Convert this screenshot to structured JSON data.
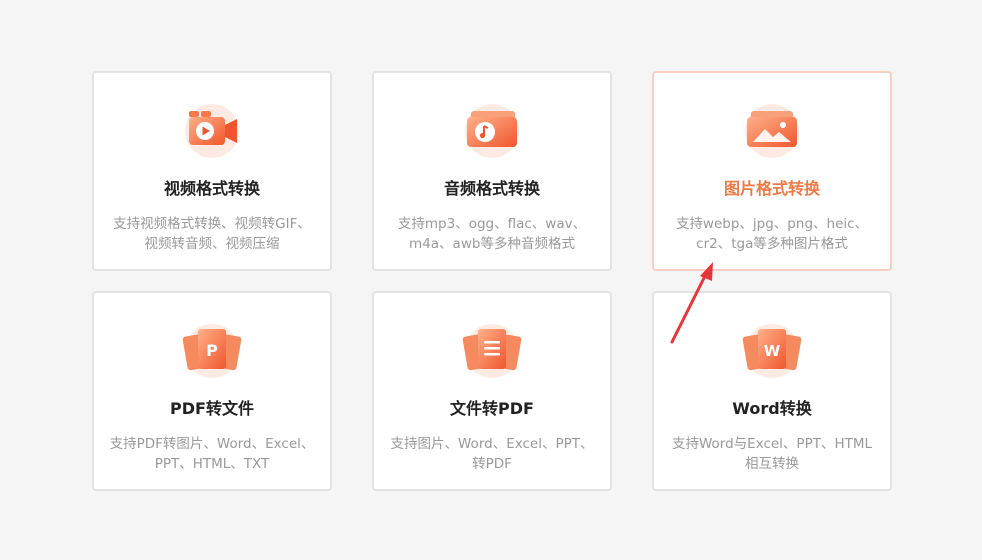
{
  "cards": [
    {
      "title": "视频格式转换",
      "desc": "支持视频格式转换、视频转GIF、视频转音频、视频压缩",
      "icon": "video-icon"
    },
    {
      "title": "音频格式转换",
      "desc": "支持mp3、ogg、flac、wav、m4a、awb等多种音频格式",
      "icon": "audio-icon"
    },
    {
      "title": "图片格式转换",
      "desc": "支持webp、jpg、png、heic、cr2、tga等多种图片格式",
      "icon": "image-icon",
      "active": true
    },
    {
      "title": "PDF转文件",
      "desc": "支持PDF转图片、Word、Excel、PPT、HTML、TXT",
      "icon": "pdf-icon"
    },
    {
      "title": "文件转PDF",
      "desc": "支持图片、Word、Excel、PPT、转PDF",
      "icon": "doc-to-pdf-icon"
    },
    {
      "title": "Word转换",
      "desc": "支持Word与Excel、PPT、HTML 相互转换",
      "icon": "word-icon"
    }
  ],
  "colors": {
    "accent": "#f07a45",
    "arrow": "#e8353a",
    "border": "#e3e3e3",
    "active_border": "#f6cfc0"
  },
  "icon_letters": {
    "pdf": "P",
    "word": "W"
  }
}
